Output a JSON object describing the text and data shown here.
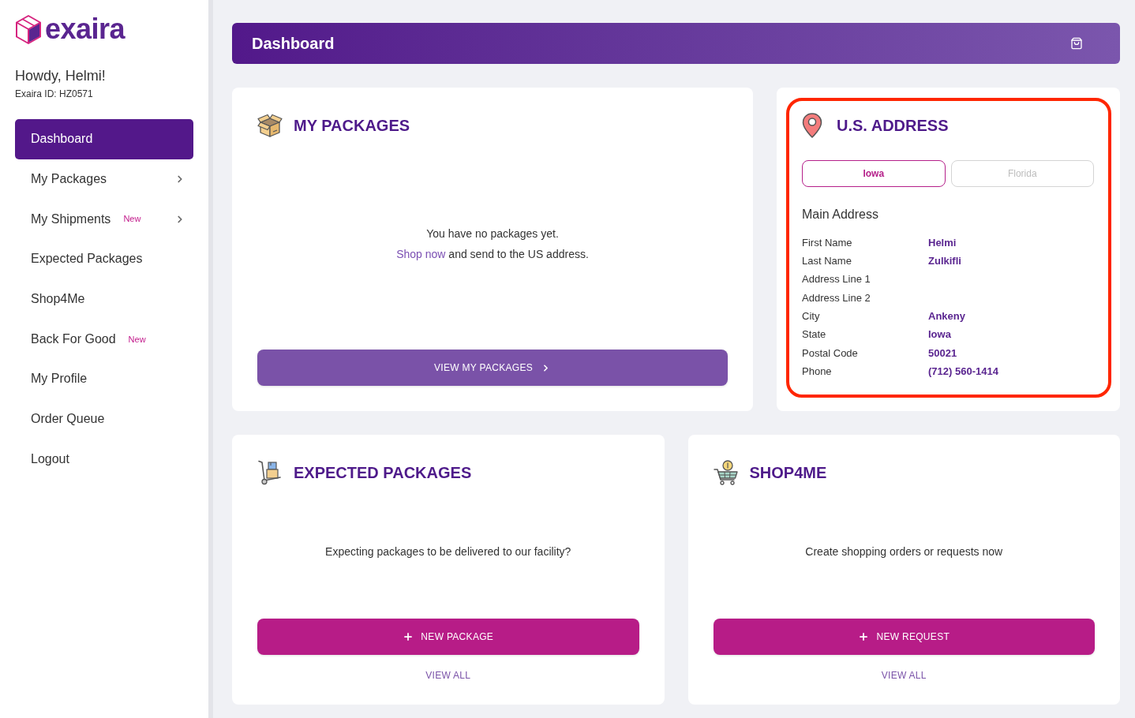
{
  "sidebar": {
    "logo": "exaira",
    "greeting": "Howdy, Helmi!",
    "member_id": "Exaira ID: HZ0571",
    "items": [
      {
        "label": "Dashboard",
        "selected": true,
        "has_submenu": false
      },
      {
        "label": "My Packages",
        "selected": false,
        "has_submenu": true
      },
      {
        "label": "My Shipments",
        "selected": false,
        "has_submenu": true,
        "badge": "New"
      },
      {
        "label": "Expected Packages",
        "selected": false,
        "has_submenu": false
      },
      {
        "label": "Shop4Me",
        "selected": false,
        "has_submenu": false
      },
      {
        "label": "Back For Good",
        "selected": false,
        "has_submenu": false,
        "badge": "New"
      },
      {
        "label": "My Profile",
        "selected": false,
        "has_submenu": false
      },
      {
        "label": "Order Queue",
        "selected": false,
        "has_submenu": false
      },
      {
        "label": "Logout",
        "selected": false,
        "has_submenu": false
      }
    ]
  },
  "header": {
    "title": "Dashboard"
  },
  "my_packages": {
    "title": "MY PACKAGES",
    "message": "You have no packages yet.",
    "hint": {
      "link": "Shop now",
      "text": "and send to the US address."
    },
    "button": "VIEW MY PACKAGES"
  },
  "us_address": {
    "title": "U.S. ADDRESS",
    "highlighted": true,
    "tabs": [
      {
        "label": "Iowa",
        "selected": true
      },
      {
        "label": "Florida",
        "selected": false
      }
    ],
    "section_title": "Main Address",
    "fields": [
      {
        "label": "First Name",
        "value": "Helmi"
      },
      {
        "label": "Last Name",
        "value": "Zulkifli"
      },
      {
        "label": "Address Line 1"
      },
      {
        "label": "Address Line 2"
      },
      {
        "label": "City",
        "value": "Ankeny"
      },
      {
        "label": "State",
        "value": "Iowa"
      },
      {
        "label": "Postal Code",
        "value": "50021"
      },
      {
        "label": "Phone",
        "value": "(712) 560-1414"
      }
    ]
  },
  "expected_packages": {
    "title": "EXPECTED PACKAGES",
    "message": "Expecting packages to be delivered to our facility?",
    "button": "NEW PACKAGE",
    "link": "VIEW ALL"
  },
  "shop4me": {
    "title": "SHOP4ME",
    "message": "Create shopping orders or requests now",
    "button": "NEW REQUEST",
    "link": "VIEW ALL"
  }
}
